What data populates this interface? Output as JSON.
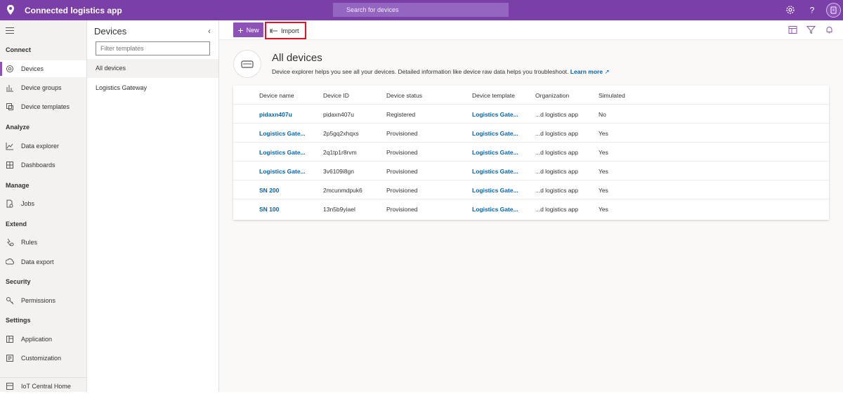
{
  "app": {
    "title": "Connected logistics app",
    "search_placeholder": "Search for devices",
    "accent": "#7b3fa8"
  },
  "topbar_icons": [
    "settings-icon",
    "help-icon",
    "user-avatar-icon"
  ],
  "leftnav": {
    "sections": [
      {
        "title": "Connect",
        "items": [
          "Devices",
          "Device groups",
          "Device templates"
        ]
      },
      {
        "title": "Analyze",
        "items": [
          "Data explorer",
          "Dashboards"
        ]
      },
      {
        "title": "Manage",
        "items": [
          "Jobs"
        ]
      },
      {
        "title": "Extend",
        "items": [
          "Rules",
          "Data export"
        ]
      },
      {
        "title": "Security",
        "items": [
          "Permissions"
        ]
      },
      {
        "title": "Settings",
        "items": [
          "Application",
          "Customization"
        ]
      }
    ],
    "footer": "IoT Central Home",
    "active": "Devices"
  },
  "templates": {
    "title": "Devices",
    "filter_placeholder": "Filter templates",
    "items": [
      "All devices",
      "Logistics Gateway"
    ]
  },
  "commands": {
    "new_label": "New",
    "import_label": "Import"
  },
  "hero": {
    "title": "All devices",
    "description": "Device explorer helps you see all your devices. Detailed information like device raw data helps you troubleshoot.",
    "link": "Learn more"
  },
  "table": {
    "columns": [
      "Device name",
      "Device ID",
      "Device status",
      "Device template",
      "Organization",
      "Simulated"
    ],
    "rows": [
      {
        "name": "pidaxn407u",
        "id": "pidaxn407u",
        "status": "Registered",
        "template": "Logistics Gate...",
        "org": "...d logistics app",
        "simulated": "No"
      },
      {
        "name": "Logistics Gate...",
        "id": "2p5gq2xhqxs",
        "status": "Provisioned",
        "template": "Logistics Gate...",
        "org": "...d logistics app",
        "simulated": "Yes"
      },
      {
        "name": "Logistics Gate...",
        "id": "2q1tp1r8rvm",
        "status": "Provisioned",
        "template": "Logistics Gate...",
        "org": "...d logistics app",
        "simulated": "Yes"
      },
      {
        "name": "Logistics Gate...",
        "id": "3v6109i8gn",
        "status": "Provisioned",
        "template": "Logistics Gate...",
        "org": "...d logistics app",
        "simulated": "Yes"
      },
      {
        "name": "SN 200",
        "id": "2mcunmdpuk6",
        "status": "Provisioned",
        "template": "Logistics Gate...",
        "org": "...d logistics app",
        "simulated": "Yes"
      },
      {
        "name": "SN 100",
        "id": "13n5b9yiael",
        "status": "Provisioned",
        "template": "Logistics Gate...",
        "org": "...d logistics app",
        "simulated": "Yes"
      }
    ]
  }
}
